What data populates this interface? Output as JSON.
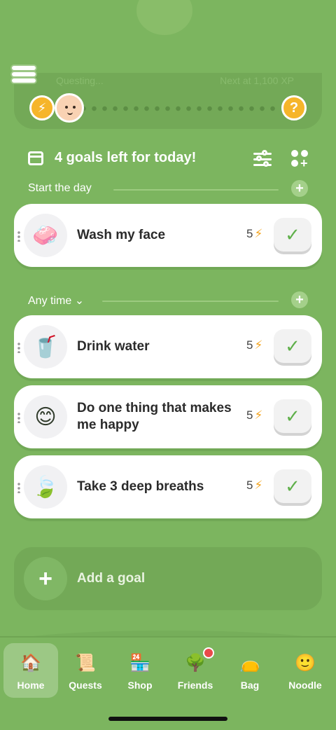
{
  "progress": {
    "faded_left": "Questing...",
    "faded_right": "Next at 1,100 XP",
    "bolt_symbol": "⚡",
    "help_symbol": "?"
  },
  "goals_header": {
    "title": "4 goals left for today!"
  },
  "sections": [
    {
      "label": "Start the day",
      "add_symbol": "+"
    },
    {
      "label": "Any time",
      "chevron": "⌄",
      "add_symbol": "+"
    }
  ],
  "goals": [
    {
      "title": "Wash my face",
      "energy": "5",
      "icon": "soap-icon",
      "glyph": "🧼",
      "check": "✓"
    },
    {
      "title": "Drink water",
      "energy": "5",
      "icon": "water-glass-icon",
      "glyph": "🥤",
      "check": "✓"
    },
    {
      "title": "Do one thing that makes me happy",
      "energy": "5",
      "icon": "smiley-icon",
      "glyph": "😊",
      "check": "✓"
    },
    {
      "title": "Take 3 deep breaths",
      "energy": "5",
      "icon": "leaf-wind-icon",
      "glyph": "🍃",
      "check": "✓"
    }
  ],
  "energy_symbol": "⚡",
  "add_goal": {
    "label": "Add a goal",
    "plus": "+"
  },
  "nav": [
    {
      "label": "Home",
      "icon": "house-icon",
      "glyph": "🏠",
      "active": true
    },
    {
      "label": "Quests",
      "icon": "quest-map-icon",
      "glyph": "📜",
      "active": false
    },
    {
      "label": "Shop",
      "icon": "shop-icon",
      "glyph": "🏪",
      "active": false
    },
    {
      "label": "Friends",
      "icon": "tree-icon",
      "glyph": "🌳",
      "active": false
    },
    {
      "label": "Bag",
      "icon": "bag-icon",
      "glyph": "👝",
      "active": false
    },
    {
      "label": "Noodle",
      "icon": "noodle-face-icon",
      "glyph": "🙂",
      "active": false
    }
  ],
  "colors": {
    "background": "#7cb55f",
    "energy": "#f4a623",
    "check": "#5fb04a"
  }
}
